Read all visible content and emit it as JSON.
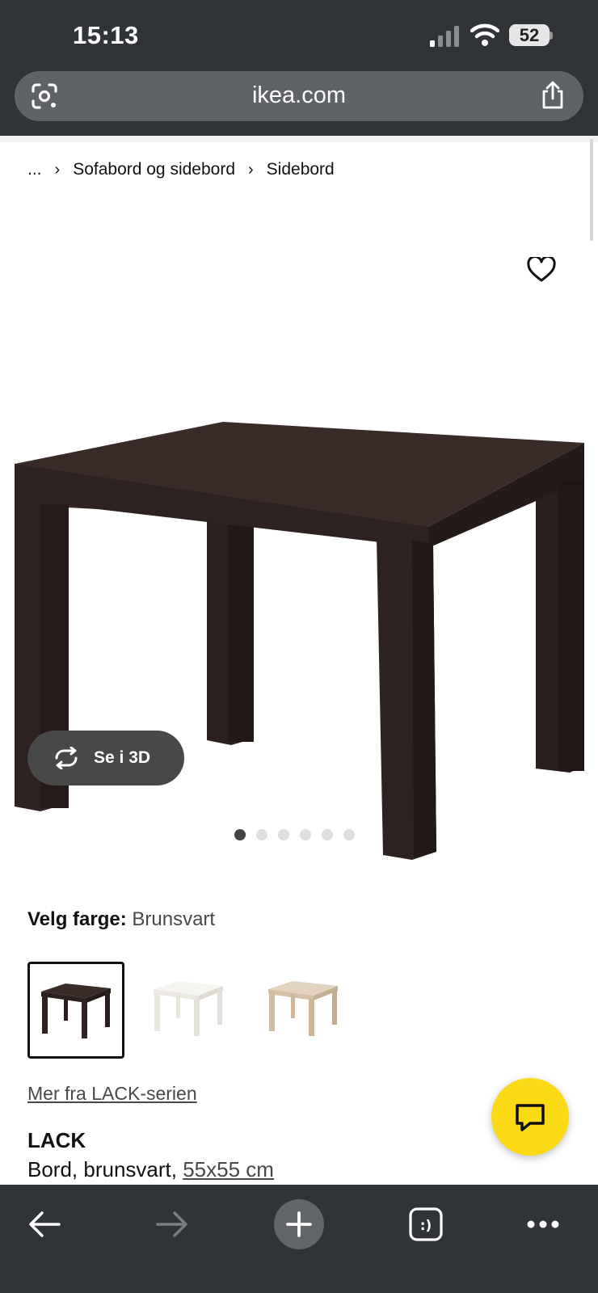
{
  "status_bar": {
    "time": "15:13",
    "battery": "52"
  },
  "browser": {
    "url": "ikea.com"
  },
  "breadcrumb": {
    "items": [
      "...",
      "Sofabord og sidebord",
      "Sidebord"
    ]
  },
  "product_viewer": {
    "view_3d_label": "Se i 3D",
    "image_count": 6,
    "active_image": 1
  },
  "color_picker": {
    "label": "Velg farge:",
    "selected_value": "Brunsvart",
    "options": [
      {
        "name": "Brunsvart",
        "color": "#2e2220",
        "selected": true
      },
      {
        "name": "white",
        "color": "#f4f2ec",
        "selected": false
      },
      {
        "name": "white-stained-oak",
        "color": "#d9c7ad",
        "selected": false
      }
    ]
  },
  "series_link": "Mer fra LACK-serien",
  "product": {
    "name": "LACK",
    "desc_prefix": "Bord, brunsvart, ",
    "size": "55x55 cm"
  },
  "colors": {
    "chrome": "#303338",
    "chat_button": "#fbd914",
    "product_dark": "#2e2220"
  },
  "icons": {
    "lens": "google-lens-icon",
    "share": "share-icon",
    "heart": "heart-icon",
    "rotate": "rotate-3d-icon",
    "chat": "chat-icon",
    "back": "back-arrow-icon",
    "forward": "forward-arrow-icon",
    "new_tab": "plus-icon",
    "tabs": "tabs-icon",
    "more": "more-icon"
  }
}
